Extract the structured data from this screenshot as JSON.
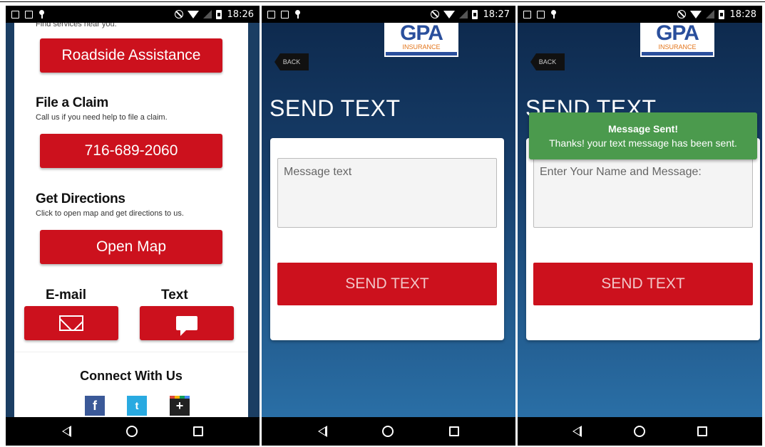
{
  "status_bar": {
    "icons_left": [
      "screenshot-icon",
      "photo-icon",
      "pin-icon"
    ],
    "icons_right": [
      "block-icon",
      "wifi-icon",
      "signal-icon",
      "battery-icon"
    ]
  },
  "screen1": {
    "time": "18:26",
    "cut_off_text": "Find services near you.",
    "roadside_button": "Roadside Assistance",
    "file_claim": {
      "title": "File a Claim",
      "description": "Call us if you need help to file a claim.",
      "phone_button": "716-689-2060"
    },
    "directions": {
      "title": "Get Directions",
      "description": "Click to open map and get directions to us.",
      "map_button": "Open Map"
    },
    "email_label": "E-mail",
    "text_label": "Text",
    "connect_title": "Connect With Us",
    "social": {
      "facebook": "f",
      "twitter": "t",
      "googleplus": "+"
    }
  },
  "screen2": {
    "time": "18:27",
    "logo": {
      "main": "GPA",
      "sub": "INSURANCE"
    },
    "back_label": "BACK",
    "title": "SEND TEXT",
    "message_placeholder": "Message text",
    "send_button": "SEND TEXT"
  },
  "screen3": {
    "time": "18:28",
    "logo": {
      "main": "GPA",
      "sub": "INSURANCE"
    },
    "back_label": "BACK",
    "title": "SEND TEXT",
    "message_placeholder": "Enter Your Name and Message:",
    "send_button": "SEND TEXT",
    "toast": {
      "title": "Message Sent!",
      "message": "Thanks! your text message has been sent."
    }
  },
  "colors": {
    "accent_red": "#cc111d",
    "toast_green": "#4b9a4d",
    "logo_blue": "#2a4f9c",
    "background_navy": "#0f2e52"
  }
}
